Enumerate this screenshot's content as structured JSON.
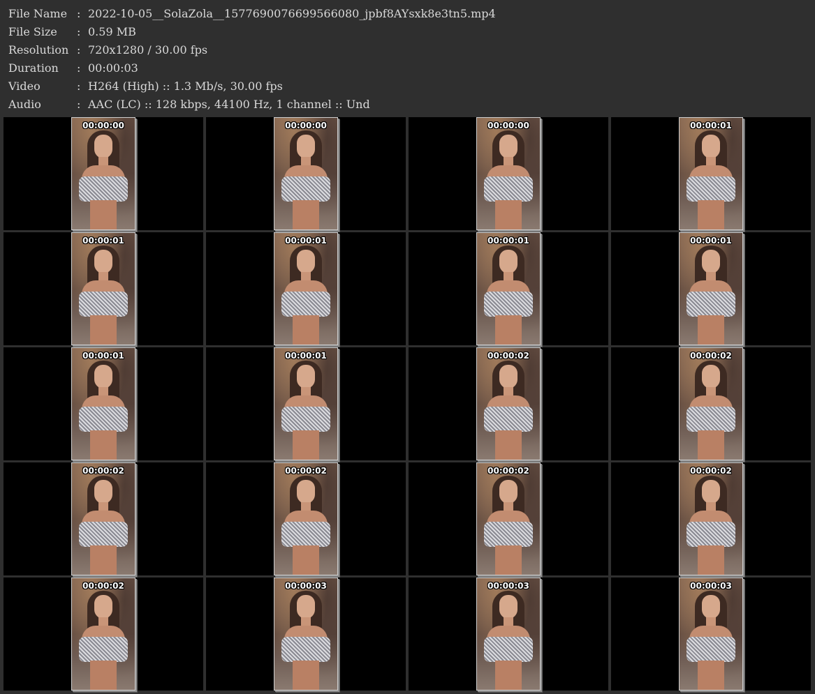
{
  "info": [
    {
      "label": "File Name",
      "value": "2022-10-05__SolaZola__1577690076699566080_jpbf8AYsxk8e3tn5.mp4"
    },
    {
      "label": "File Size",
      "value": "0.59 MB"
    },
    {
      "label": "Resolution",
      "value": "720x1280 / 30.00 fps"
    },
    {
      "label": "Duration",
      "value": "00:00:03"
    },
    {
      "label": "Video",
      "value": "H264 (High) :: 1.3 Mb/s, 30.00 fps"
    },
    {
      "label": "Audio",
      "value": "AAC (LC) :: 128 kbps, 44100 Hz, 1 channel :: Und"
    }
  ],
  "separator": ":",
  "thumbnails": [
    "00:00:00",
    "00:00:00",
    "00:00:00",
    "00:00:01",
    "00:00:01",
    "00:00:01",
    "00:00:01",
    "00:00:01",
    "00:00:01",
    "00:00:01",
    "00:00:02",
    "00:00:02",
    "00:00:02",
    "00:00:02",
    "00:00:02",
    "00:00:02",
    "00:00:02",
    "00:00:03",
    "00:00:03",
    "00:00:03"
  ],
  "colors": {
    "background": "#2f2f2f",
    "text": "#d9d9d9",
    "cell_background": "#000000",
    "timestamp": "#ffffff"
  }
}
